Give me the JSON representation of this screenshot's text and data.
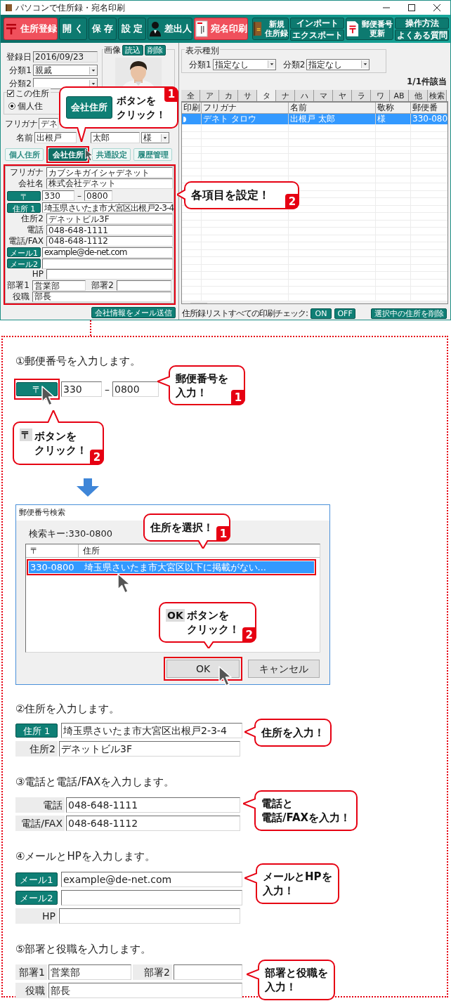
{
  "window": {
    "title": "パソコンで住所録・宛名印刷"
  },
  "toolbar": [
    {
      "kind": "postal",
      "highlighted": true,
      "lines": [
        "住所登録"
      ]
    },
    {
      "kind": "text",
      "highlighted": false,
      "lines": [
        "開 く"
      ]
    },
    {
      "kind": "text",
      "highlighted": false,
      "lines": [
        "保 存"
      ]
    },
    {
      "kind": "text",
      "highlighted": false,
      "lines": [
        "設 定"
      ]
    },
    {
      "kind": "person",
      "highlighted": false,
      "lines": [
        "差出人"
      ]
    },
    {
      "kind": "card",
      "highlighted": true,
      "lines": [
        "宛名印刷"
      ]
    },
    {
      "kind": "book",
      "highlighted": false,
      "lines": [
        "新規",
        "住所録"
      ]
    },
    {
      "kind": "pair",
      "items": [
        "インポート",
        "エクスポート"
      ]
    },
    {
      "kind": "postal",
      "highlighted": false,
      "lines": [
        "郵便番号",
        "更新"
      ]
    },
    {
      "kind": "pair",
      "items": [
        "操作方法",
        "よくある質問"
      ]
    }
  ],
  "record": {
    "registered": {
      "label": "登録日",
      "value": "2016/09/23"
    },
    "category1": {
      "label": "分類1",
      "value": "親戚"
    },
    "category2": {
      "label": "分類2"
    },
    "image": {
      "label": "画像",
      "buttons": [
        "読込",
        "削除"
      ]
    },
    "address_group": {
      "checkbox": {
        "label": "この住所",
        "checked": true
      },
      "radio": {
        "label": "個人住",
        "selected": true
      }
    },
    "furigana": {
      "label": "フリガナ",
      "value": "デネ"
    },
    "name": {
      "label": "名前",
      "family": "出根戸",
      "given": "太郎",
      "honorific": "様"
    },
    "tabs": [
      {
        "label": "個人住所",
        "selected": false
      },
      {
        "label": "会社住所",
        "selected": true
      },
      {
        "label": "共通設定",
        "selected": false
      },
      {
        "label": "履歴管理",
        "selected": false
      }
    ],
    "company_fields": [
      {
        "kind": "text",
        "label": "フリガナ",
        "value": "カブシキガイシャデネット"
      },
      {
        "kind": "text",
        "label": "会社名",
        "value": "株式会社デネット"
      },
      {
        "kind": "postal",
        "button": "〒",
        "first": "330",
        "separator": "–",
        "second": "0800"
      },
      {
        "kind": "button",
        "button": "住所 1",
        "value": "埼玉県さいたま市大宮区出根戸2-3-4"
      },
      {
        "kind": "text",
        "label": "住所2",
        "value": "デネットビル3F"
      },
      {
        "kind": "text",
        "label": "電話",
        "value": "048-648-1111"
      },
      {
        "kind": "text",
        "label": "電話/FAX",
        "value": "048-648-1112"
      },
      {
        "kind": "button",
        "button": "メール1",
        "value": "example@de-net.com"
      },
      {
        "kind": "button",
        "button": "メール2"
      },
      {
        "kind": "text",
        "label": "HP"
      },
      {
        "kind": "pair",
        "label": "部署1",
        "value": "営業部",
        "label2": "部署2"
      },
      {
        "kind": "short",
        "label": "役職",
        "value": "部長"
      }
    ],
    "send_button": "会社情報をメール送信"
  },
  "list": {
    "filter": {
      "title": "表示種別",
      "fields": [
        {
          "label": "分類1",
          "value": "指定なし"
        },
        {
          "label": "分類2",
          "value": "指定なし"
        }
      ]
    },
    "count": "1/1件該当",
    "index_tabs": [
      {
        "label": "全",
        "selected": false
      },
      {
        "label": "ア",
        "selected": false
      },
      {
        "label": "カ",
        "selected": false
      },
      {
        "label": "サ",
        "selected": false
      },
      {
        "label": "タ",
        "selected": true
      },
      {
        "label": "ナ",
        "selected": false
      },
      {
        "label": "ハ",
        "selected": false
      },
      {
        "label": "マ",
        "selected": false
      },
      {
        "label": "ヤ",
        "selected": false
      },
      {
        "label": "ラ",
        "selected": false
      },
      {
        "label": "ワ",
        "selected": false
      },
      {
        "label": "AB",
        "selected": false
      },
      {
        "label": "他",
        "selected": false
      },
      {
        "label": "検索",
        "selected": false
      }
    ],
    "columns": [
      "印刷",
      "フリガナ",
      "名前",
      "敬称",
      "郵便番"
    ],
    "rows": [
      {
        "selected": true,
        "cells": [
          "",
          "デネト タロウ",
          "出根戸 太郎",
          "様",
          "330-080"
        ]
      }
    ],
    "footer": {
      "label": "住所録リストすべての印刷チェック:",
      "buttons": [
        "ON",
        "OFF"
      ],
      "delete": "選択中の住所を削除"
    }
  },
  "callouts": [
    {
      "chip": {
        "kind": "button",
        "label": "会社住所"
      },
      "lines": [
        "ボタンを",
        "クリック！"
      ],
      "badge": "1"
    },
    {
      "lines": [
        "各項目を設定！"
      ],
      "badge": "2"
    }
  ],
  "steps": [
    {
      "kind": "postal",
      "title": "①郵便番号を入力します。",
      "button": "〒",
      "first": "330",
      "separator": "–",
      "second": "0800",
      "callouts": [
        {
          "lines": [
            "郵便番号を",
            "入力！"
          ],
          "badge": "1"
        },
        {
          "chip": {
            "kind": "key",
            "label": "〒"
          },
          "lines": [
            "ボタンを",
            "クリック！"
          ],
          "badge": "2"
        }
      ],
      "dialog": {
        "title": "郵便番号検索",
        "search_key": "検索キー:330-0800",
        "columns": [
          "〒",
          "住所"
        ],
        "rows": [
          {
            "selected": true,
            "cells": [
              "330-0800",
              "埼玉県さいたま市大宮区以下に掲載がない..."
            ]
          }
        ],
        "buttons": [
          "OK",
          "キャンセル"
        ],
        "callouts": [
          {
            "lines": [
              "住所を選択！"
            ],
            "badge": "1"
          },
          {
            "chip": {
              "kind": "key",
              "label": "OK"
            },
            "lines": [
              "ボタンを",
              "クリック！"
            ],
            "badge": "2"
          }
        ]
      }
    },
    {
      "kind": "fields",
      "title": "②住所を入力します。",
      "fields": [
        {
          "kind": "button",
          "button": "住所 1",
          "value": "埼玉県さいたま市大宮区出根戸2-3-4"
        },
        {
          "kind": "text",
          "label": "住所2",
          "value": "デネットビル3F"
        }
      ],
      "callout": {
        "lines": [
          "住所を入力！"
        ]
      }
    },
    {
      "kind": "fields",
      "title": "③電話と電話/FAXを入力します。",
      "fields": [
        {
          "kind": "text",
          "label": "電話",
          "value": "048-648-1111"
        },
        {
          "kind": "text",
          "label": "電話/FAX",
          "value": "048-648-1112"
        }
      ],
      "callout": {
        "lines": [
          "電話と",
          "電話/FAXを入力！"
        ]
      }
    },
    {
      "kind": "fields",
      "title": "④メールとHPを入力します。",
      "fields": [
        {
          "kind": "button",
          "button": "メール1",
          "value": "example@de-net.com"
        },
        {
          "kind": "button",
          "button": "メール2"
        },
        {
          "kind": "text",
          "label": "HP"
        }
      ],
      "callout": {
        "lines": [
          "メールとHPを",
          "入力！"
        ]
      }
    },
    {
      "kind": "fields",
      "title": "⑤部署と役職を入力します。",
      "fields": [
        {
          "kind": "pair",
          "label": "部署1",
          "value": "営業部",
          "label2": "部署2"
        },
        {
          "kind": "short",
          "label": "役職",
          "value": "部長"
        }
      ],
      "callout": {
        "lines": [
          "部署と役職を",
          "入力！"
        ]
      }
    }
  ]
}
